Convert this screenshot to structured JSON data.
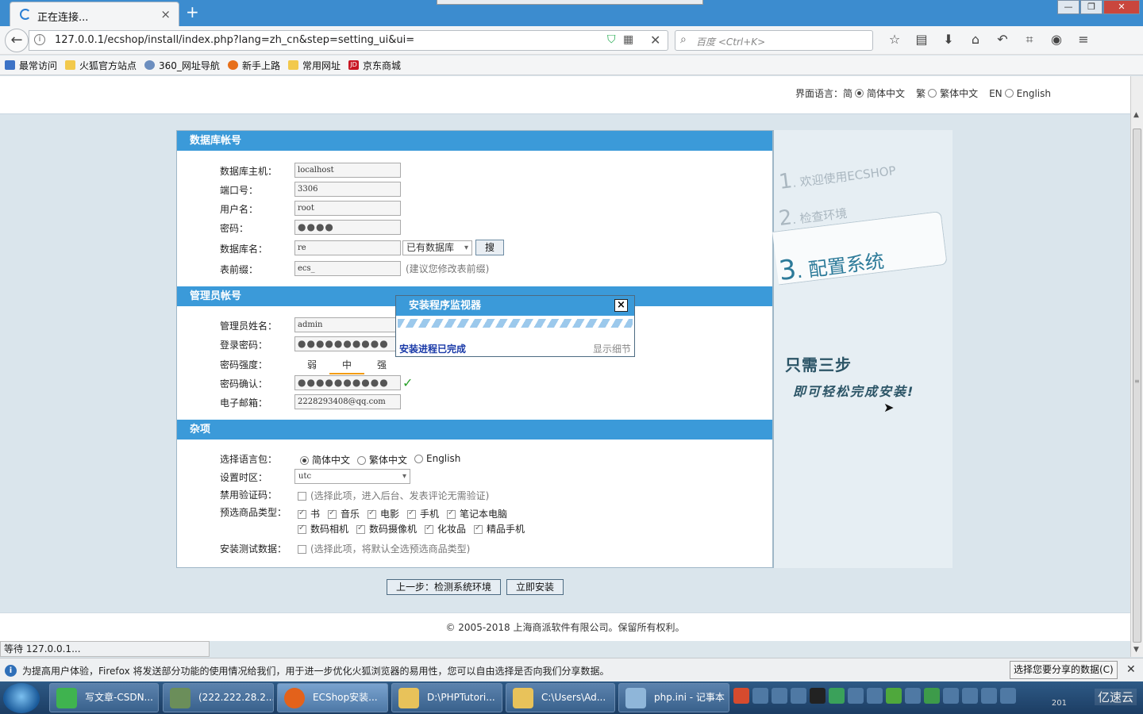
{
  "browser": {
    "tab_title": "正在连接...",
    "tab_close": "×",
    "new_tab": "+",
    "url": "127.0.0.1/ecshop/install/index.php?lang=zh_cn&step=setting_ui&ui=",
    "search_placeholder": "百度 <Ctrl+K>",
    "bookmarks": [
      "最常访问",
      "火狐官方站点",
      "360_网址导航",
      "新手上路",
      "常用网址",
      "京东商城"
    ],
    "status_text": "等待 127.0.0.1..."
  },
  "lang_bar": {
    "label": "界面语言：简",
    "opt_simplified": "简体中文",
    "prefix_traditional": "繁",
    "opt_traditional": "繁体中文",
    "prefix_en": "EN",
    "opt_english": "English",
    "selected": "simplified"
  },
  "db_section": {
    "title": "数据库帐号",
    "host_label": "数据库主机：",
    "host_value": "localhost",
    "port_label": "端口号：",
    "port_value": "3306",
    "user_label": "用户名：",
    "user_value": "root",
    "pass_label": "密码：",
    "pass_value": "●●●●",
    "dbname_label": "数据库名：",
    "dbname_value": "re",
    "dbname_select": "已有数据库",
    "search_button": "搜",
    "prefix_label": "表前缀：",
    "prefix_value": "ecs_",
    "prefix_hint": "(建议您修改表前缀)"
  },
  "admin_section": {
    "title": "管理员帐号",
    "name_label": "管理员姓名：",
    "name_value": "admin",
    "pass_label": "登录密码：",
    "pass_value": "●●●●●●●●●●",
    "strength_label": "密码强度：",
    "strength_levels": [
      "弱",
      "中",
      "强"
    ],
    "strength_current": "中",
    "confirm_label": "密码确认：",
    "confirm_value": "●●●●●●●●●●",
    "email_label": "电子邮箱：",
    "email_value": "2228293408@qq.com"
  },
  "misc_section": {
    "title": "杂项",
    "lang_label": "选择语言包：",
    "lang_options": [
      "简体中文",
      "繁体中文",
      "English"
    ],
    "timezone_label": "设置时区：",
    "timezone_value": "utc",
    "captcha_label": "禁用验证码：",
    "captcha_hint": "(选择此项，进入后台、发表评论无需验证)",
    "goods_label": "预选商品类型：",
    "goods_types_row1": [
      "书",
      "音乐",
      "电影",
      "手机",
      "笔记本电脑"
    ],
    "goods_types_row2": [
      "数码相机",
      "数码摄像机",
      "化妆品",
      "精品手机"
    ],
    "testdata_label": "安装测试数据：",
    "testdata_hint": "(选择此项，将默认全选预选商品类型)"
  },
  "side_panel": {
    "step1_num": "1",
    "step1_text": "欢迎使用ECSHOP",
    "step2_num": "2",
    "step2_text": "检查环境",
    "step3_num": "3",
    "step3_text": "配置系统",
    "slogan1": "只需三步",
    "slogan2": "即可轻松完成安装!"
  },
  "monitor": {
    "title": "安装程序监视器",
    "close": "×",
    "status": "安装进程已完成",
    "detail": "显示细节"
  },
  "buttons": {
    "prev": "上一步：检测系统环境",
    "install": "立即安装"
  },
  "footer": {
    "copyright": "© 2005-2018 上海商派软件有限公司。保留所有权利。"
  },
  "notice_bar": {
    "message": "为提高用户体验，Firefox 将发送部分功能的使用情况给我们，用于进一步优化火狐浏览器的易用性，您可以自由选择是否向我们分享数据。",
    "choose_button": "选择您要分享的数据(C)"
  },
  "taskbar": {
    "tasks": [
      "写文章-CSDN...",
      "(222.222.28.2...",
      "ECShop安装...",
      "D:\\PHPTutori...",
      "C:\\Users\\Ad...",
      "php.ini - 记事本"
    ],
    "brand": "亿速云",
    "clock": "201"
  },
  "colors": {
    "section_blue": "#3b9ad9",
    "accent_teal": "#2c7a99",
    "ok_green": "#2aa12a"
  }
}
